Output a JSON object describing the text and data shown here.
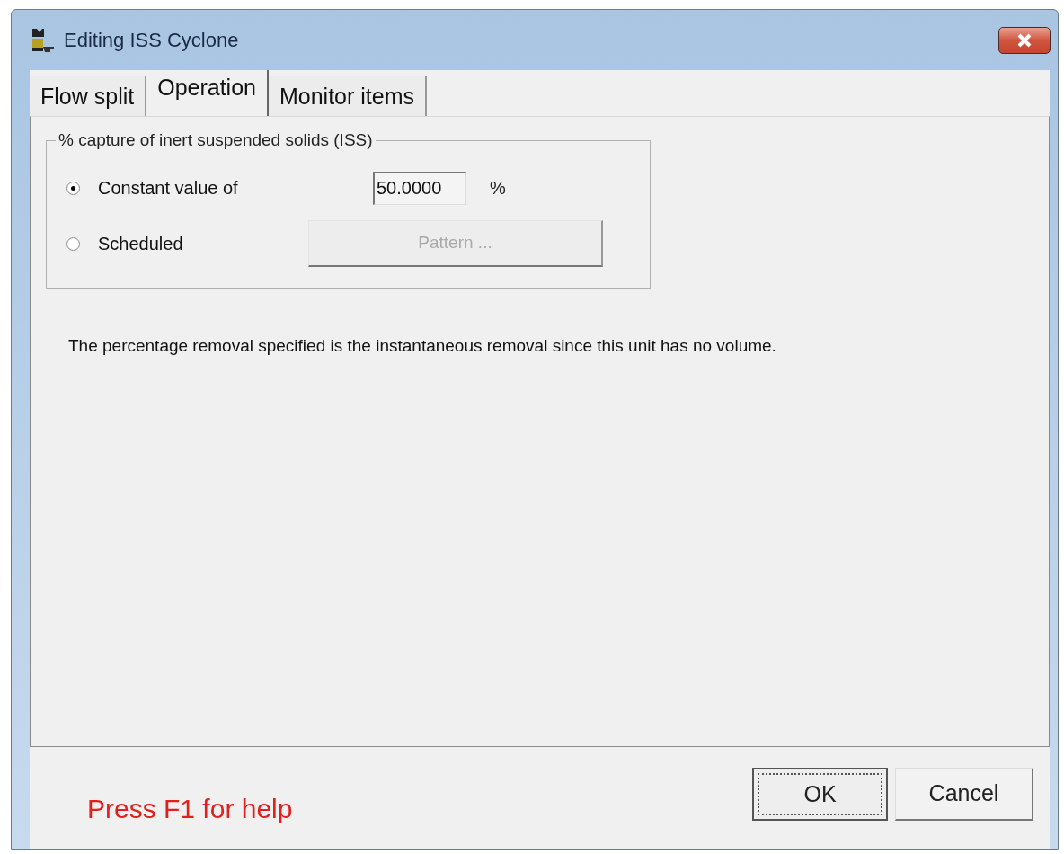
{
  "window": {
    "title": "Editing ISS Cyclone"
  },
  "tabs": [
    {
      "label": "Flow split",
      "selected": false
    },
    {
      "label": "Operation",
      "selected": true
    },
    {
      "label": "Monitor items",
      "selected": false
    }
  ],
  "group": {
    "legend": "% capture of inert suspended solids (ISS)",
    "options": [
      {
        "kind": "value",
        "label": "Constant value of",
        "selected": true,
        "value": "50.0000",
        "unit": "%"
      },
      {
        "kind": "button",
        "label": "Scheduled",
        "selected": false,
        "button": "Pattern ...",
        "disabled": true
      }
    ]
  },
  "note": "The percentage removal specified is the instantaneous removal since this unit has no volume.",
  "help": "Press F1 for help",
  "buttons": [
    {
      "label": "OK",
      "focused": true
    },
    {
      "label": "Cancel",
      "focused": false
    }
  ]
}
